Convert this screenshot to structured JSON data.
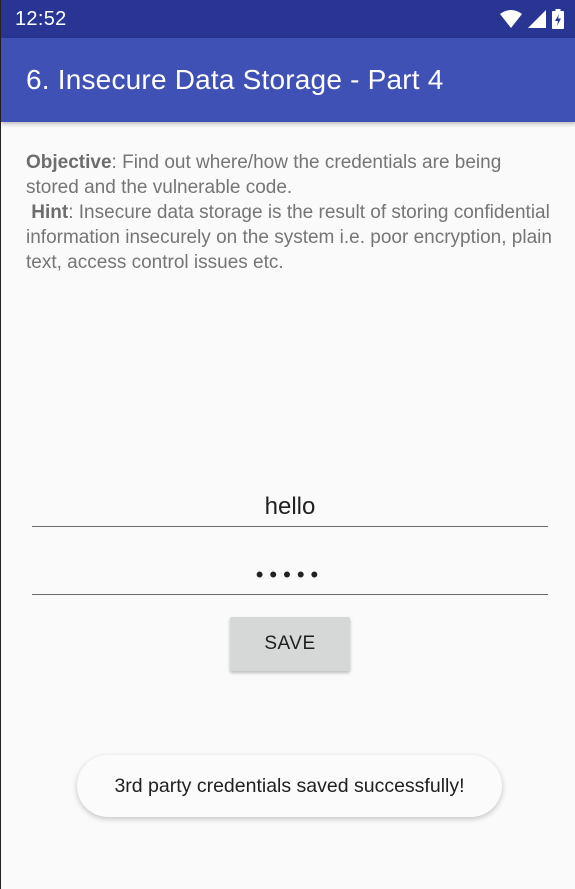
{
  "status_bar": {
    "time": "12:52",
    "icons": [
      "wifi-icon",
      "signal-icon",
      "battery-charging-icon"
    ]
  },
  "app_bar": {
    "title": "6. Insecure Data Storage - Part 4"
  },
  "description": {
    "objective_label": "Objective",
    "objective_text": ": Find out where/how the credentials are being stored and the vulnerable code.",
    "hint_label": "Hint",
    "hint_text": ": Insecure data storage is the result of storing confidential information insecurely on the system i.e. poor encryption, plain text, access control issues etc."
  },
  "form": {
    "username_value": "hello",
    "password_value": "•••••",
    "save_label": "SAVE"
  },
  "toast": {
    "message": "3rd party credentials saved successfully!"
  },
  "colors": {
    "status_bar": "#283593",
    "app_bar": "#3f51b5",
    "background": "#fafafa"
  }
}
